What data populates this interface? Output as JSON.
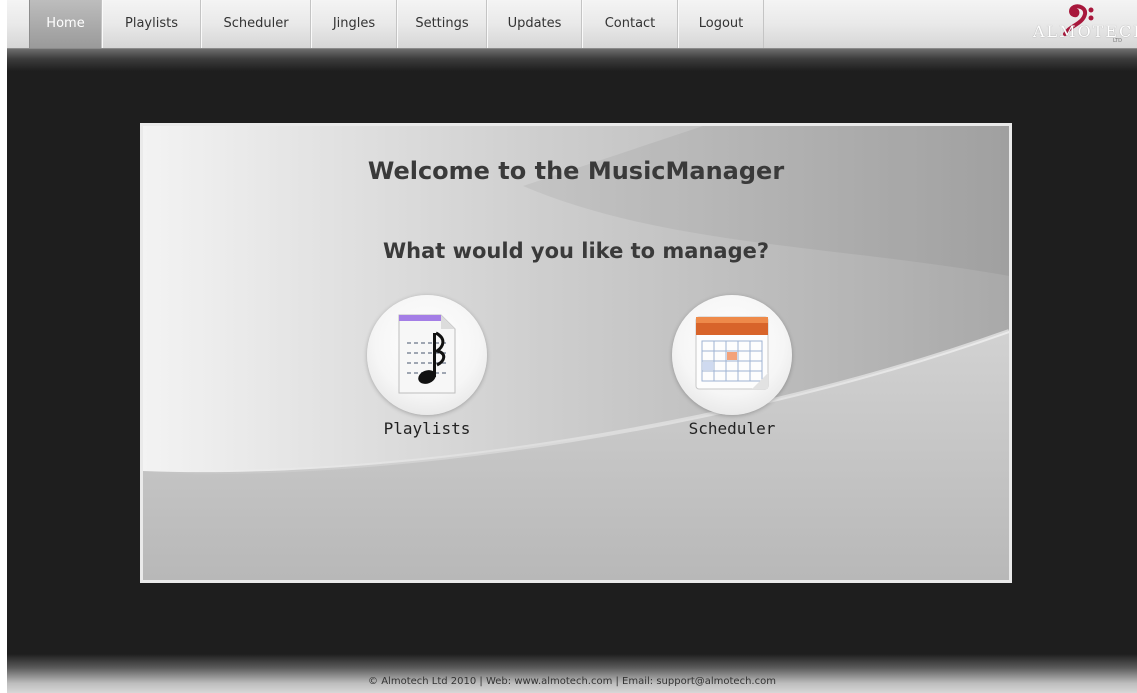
{
  "nav": {
    "items": [
      {
        "label": "Home",
        "active": true
      },
      {
        "label": "Playlists",
        "active": false
      },
      {
        "label": "Scheduler",
        "active": false
      },
      {
        "label": "Jingles",
        "active": false
      },
      {
        "label": "Settings",
        "active": false
      },
      {
        "label": "Updates",
        "active": false
      },
      {
        "label": "Contact",
        "active": false
      },
      {
        "label": "Logout",
        "active": false
      }
    ]
  },
  "logo": {
    "text": "ALMOTECH",
    "icon": "bass-clef-icon",
    "color": "#a8183c"
  },
  "main": {
    "title": "Welcome to the MusicManager",
    "question": "What would you like to manage?",
    "choices": [
      {
        "label": "Playlists",
        "icon": "music-document-icon"
      },
      {
        "label": "Scheduler",
        "icon": "calendar-icon"
      }
    ]
  },
  "footer": {
    "text": "© Almotech Ltd 2010 | Web: www.almotech.com | Email: support@almotech.com"
  }
}
